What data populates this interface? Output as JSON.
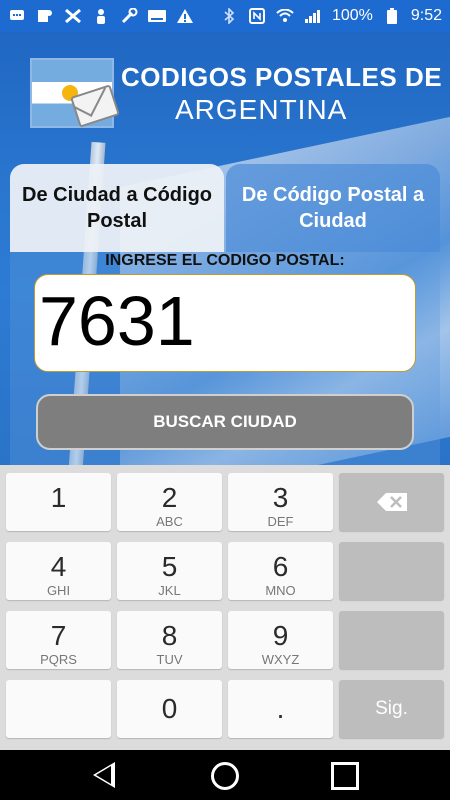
{
  "status_bar": {
    "battery": "100%",
    "time": "9:52"
  },
  "header": {
    "title_line1": "CODIGOS POSTALES DE",
    "title_line2": "ARGENTINA"
  },
  "tabs": [
    {
      "label": "De Ciudad a Código Postal"
    },
    {
      "label": "De Código Postal a Ciudad"
    }
  ],
  "form": {
    "label": "INGRESE EL CODIGO POSTAL:",
    "value": "7631",
    "search_label": "BUSCAR CIUDAD"
  },
  "keyboard": {
    "keys": [
      {
        "num": "1",
        "letters": ""
      },
      {
        "num": "2",
        "letters": "ABC"
      },
      {
        "num": "3",
        "letters": "DEF"
      },
      {
        "num": "4",
        "letters": "GHI"
      },
      {
        "num": "5",
        "letters": "JKL"
      },
      {
        "num": "6",
        "letters": "MNO"
      },
      {
        "num": "7",
        "letters": "PQRS"
      },
      {
        "num": "8",
        "letters": "TUV"
      },
      {
        "num": "9",
        "letters": "WXYZ"
      },
      {
        "num": "0",
        "letters": ""
      },
      {
        "num": ".",
        "letters": ""
      }
    ],
    "next_label": "Sig."
  }
}
